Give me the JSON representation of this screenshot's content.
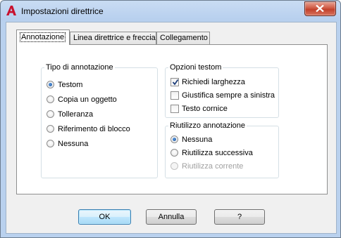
{
  "window": {
    "title": "Impostazioni direttrice"
  },
  "tabs": [
    {
      "label": "Annotazione",
      "active": true
    },
    {
      "label": "Linea direttrice e freccia",
      "active": false
    },
    {
      "label": "Collegamento",
      "active": false
    }
  ],
  "annotation_type": {
    "legend": "Tipo di annotazione",
    "options": [
      {
        "label": "Testom",
        "checked": true
      },
      {
        "label": "Copia un oggetto",
        "checked": false
      },
      {
        "label": "Tolleranza",
        "checked": false
      },
      {
        "label": "Riferimento di blocco",
        "checked": false
      },
      {
        "label": "Nessuna",
        "checked": false
      }
    ]
  },
  "mtext_options": {
    "legend": "Opzioni testom",
    "options": [
      {
        "label": "Richiedi larghezza",
        "checked": true
      },
      {
        "label": "Giustifica sempre a sinistra",
        "checked": false
      },
      {
        "label": "Testo cornice",
        "checked": false
      }
    ]
  },
  "annotation_reuse": {
    "legend": "Riutilizzo annotazione",
    "options": [
      {
        "label": "Nessuna",
        "checked": true,
        "enabled": true
      },
      {
        "label": "Riutilizza successiva",
        "checked": false,
        "enabled": true
      },
      {
        "label": "Riutilizza corrente",
        "checked": false,
        "enabled": false
      }
    ]
  },
  "buttons": {
    "ok": "OK",
    "cancel": "Annulla",
    "help": "?"
  },
  "colors": {
    "title_bar": "#b9d1ee",
    "close_button": "#c2412b",
    "app_icon": "#c8102e"
  }
}
